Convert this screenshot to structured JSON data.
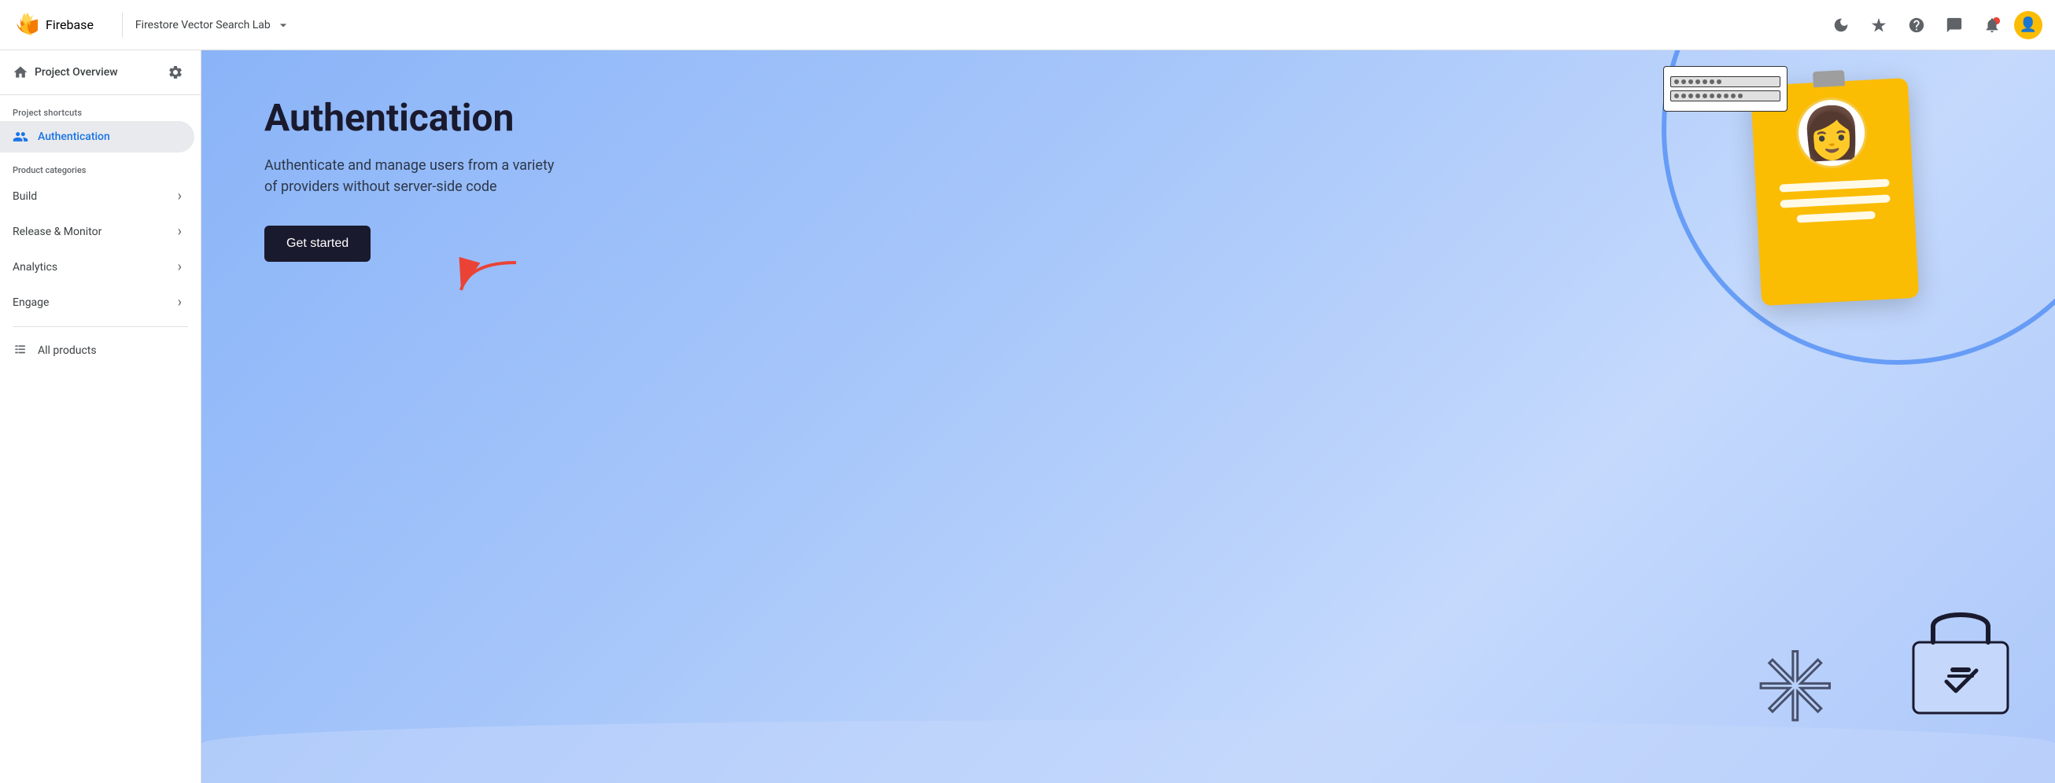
{
  "topbar": {
    "logo_text": "Firebase",
    "project_name": "Firestore Vector Search Lab",
    "project_dropdown_icon": "▼",
    "icons": {
      "dark_mode": "🌙",
      "sparkle": "✦",
      "help": "?",
      "chat": "💬",
      "notifications": "🔔"
    }
  },
  "sidebar": {
    "project_overview_label": "Project Overview",
    "project_shortcuts_label": "Project shortcuts",
    "authentication_label": "Authentication",
    "product_categories_label": "Product categories",
    "categories": [
      {
        "label": "Build"
      },
      {
        "label": "Release & Monitor"
      },
      {
        "label": "Analytics"
      },
      {
        "label": "Engage"
      }
    ],
    "all_products_label": "All products"
  },
  "main": {
    "title": "Authentication",
    "description": "Authenticate and manage users from a variety of providers without server-side code",
    "cta_label": "Get started"
  },
  "illustration": {
    "login_dots_row1": "●●●●●●●",
    "login_dots_row2": "●●●●●●●●●●"
  }
}
